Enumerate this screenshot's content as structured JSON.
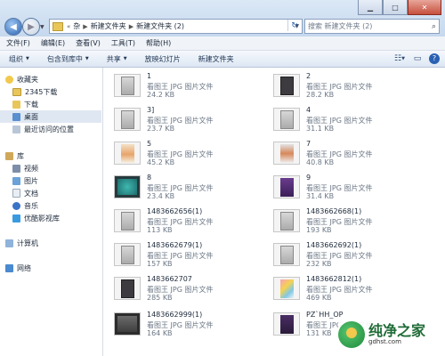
{
  "window": {
    "breadcrumb": [
      "杂",
      "新建文件夹",
      "新建文件夹 (2)"
    ],
    "breadcrumb_prefix": "«",
    "search_placeholder": "搜索 新建文件夹 (2)"
  },
  "menu": [
    "文件(F)",
    "编辑(E)",
    "查看(V)",
    "工具(T)",
    "帮助(H)"
  ],
  "toolbar": {
    "organize": "组织",
    "include_in_library": "包含到库中",
    "share": "共享",
    "slideshow": "放映幻灯片",
    "new_folder": "新建文件夹"
  },
  "sidebar": {
    "favorites": "收藏夹",
    "downloads_2345": "2345下载",
    "downloads": "下载",
    "desktop": "桌面",
    "recent": "最近访问的位置",
    "libraries": "库",
    "videos": "视频",
    "pictures": "图片",
    "documents": "文档",
    "music": "音乐",
    "youku": "优酷影视库",
    "computer": "计算机",
    "network": "网络"
  },
  "files": [
    {
      "name": "1",
      "type": "看图王 JPG 图片文件",
      "size": "24.2 KB",
      "thumb": "phone-light"
    },
    {
      "name": "2",
      "type": "看图王 JPG 图片文件",
      "size": "28.2 KB",
      "thumb": "phone-dark"
    },
    {
      "name": "3]",
      "type": "看图王 JPG 图片文件",
      "size": "23.7 KB",
      "thumb": "phone-light"
    },
    {
      "name": "4",
      "type": "看图王 JPG 图片文件",
      "size": "31.1 KB",
      "thumb": "phone-light"
    },
    {
      "name": "5",
      "type": "看图王 JPG 图片文件",
      "size": "45.2 KB",
      "thumb": "promo"
    },
    {
      "name": "7",
      "type": "看图王 JPG 图片文件",
      "size": "40.8 KB",
      "thumb": "promo2"
    },
    {
      "name": "8",
      "type": "看图王 JPG 图片文件",
      "size": "23.4 KB",
      "thumb": "wide-teal"
    },
    {
      "name": "9",
      "type": "看图王 JPG 图片文件",
      "size": "31.4 KB",
      "thumb": "purple"
    },
    {
      "name": "1483662656(1)",
      "type": "看图王 JPG 图片文件",
      "size": "113 KB",
      "thumb": "phone-light"
    },
    {
      "name": "1483662668(1)",
      "type": "看图王 JPG 图片文件",
      "size": "193 KB",
      "thumb": "phone-light"
    },
    {
      "name": "1483662679(1)",
      "type": "看图王 JPG 图片文件",
      "size": "157 KB",
      "thumb": "phone-light"
    },
    {
      "name": "1483662692(1)",
      "type": "看图王 JPG 图片文件",
      "size": "232 KB",
      "thumb": "phone-light"
    },
    {
      "name": "1483662707",
      "type": "看图王 JPG 图片文件",
      "size": "285 KB",
      "thumb": "phone-dark"
    },
    {
      "name": "1483662812(1)",
      "type": "看图王 JPG 图片文件",
      "size": "469 KB",
      "thumb": "colorful"
    },
    {
      "name": "1483662999(1)",
      "type": "看图王 JPG 图片文件",
      "size": "164 KB",
      "thumb": "wide-dark"
    },
    {
      "name": "PZ`HH_OP",
      "type": "看图王 JPG 图片文件",
      "size": "131 KB",
      "thumb": "darkpurple"
    }
  ],
  "watermark": {
    "title": "纯净之家",
    "url": "gdhst.com"
  }
}
